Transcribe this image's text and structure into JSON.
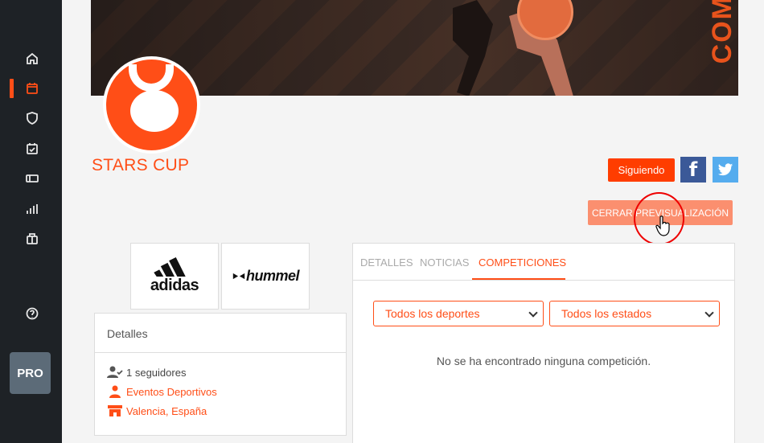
{
  "sidebar": {
    "icons": [
      "home-icon",
      "calendar-icon",
      "shield-icon",
      "calendar-check-icon",
      "ticket-icon",
      "bar-chart-icon",
      "briefcase-icon",
      "help-icon"
    ],
    "pro_label": "PRO"
  },
  "banner": {
    "text": "COM"
  },
  "org": {
    "name": "STARS CUP"
  },
  "actions": {
    "follow_label": "Siguiendo",
    "preview_label": "CERRAR PREVISUALIZACIÓN"
  },
  "sponsors": [
    "adidas",
    "hummel"
  ],
  "details": {
    "title": "Detalles",
    "followers": "1 seguidores",
    "category": "Eventos Deportivos",
    "location": "Valencia, España"
  },
  "tabs": {
    "items": [
      "DETALLES",
      "NOTICIAS",
      "COMPETICIONES"
    ],
    "active": "COMPETICIONES"
  },
  "filters": {
    "sport_selected": "Todos los deportes",
    "state_selected": "Todos los estados"
  },
  "competitions": {
    "empty_message": "No se ha encontrado ninguna competición."
  },
  "colors": {
    "accent": "#ff4e17",
    "sidebar": "#1e2226",
    "facebook": "#3b5998",
    "twitter": "#55acee"
  }
}
